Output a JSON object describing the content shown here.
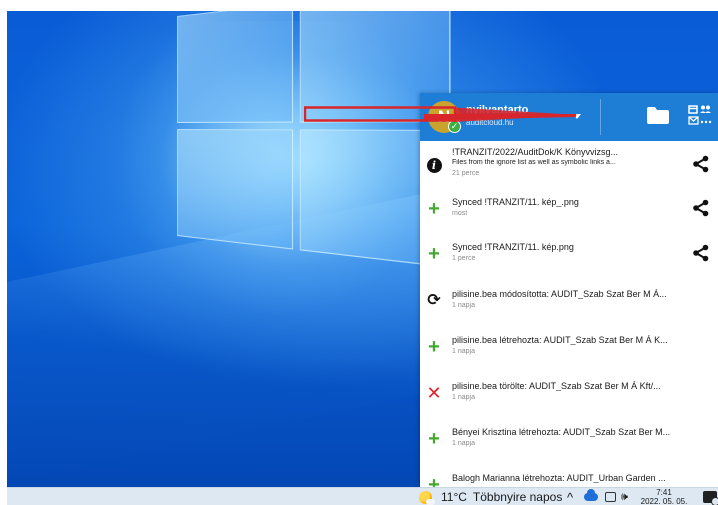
{
  "account": {
    "avatar_letter": "N",
    "name": "nyilvantarto",
    "server": "auditcloud.hu",
    "status_check": "✓"
  },
  "header": {
    "accent_color": "#1e7ed6",
    "files_icon": "folder-icon",
    "apps_icon": "apps-menu-icon"
  },
  "activities": [
    {
      "icon": "info-icon",
      "title": "!TRANZIT/2022/AuditDok/K Könyvvizsg...",
      "detail": "Files from the ignore list as well as symbolic links a...",
      "time": "21 perce",
      "has_share": true
    },
    {
      "icon": "plus-icon",
      "title": "Synced !TRANZIT/11. kép_.png",
      "detail": "",
      "time": "most",
      "has_share": true
    },
    {
      "icon": "plus-icon",
      "title": "Synced !TRANZIT/11. kép.png",
      "detail": "",
      "time": "1 perce",
      "has_share": true
    },
    {
      "icon": "sync-icon",
      "title": "pilisine.bea módosította: AUDIT_Szab Szat Ber M Á...",
      "detail": "",
      "time": "1 napja",
      "has_share": false
    },
    {
      "icon": "plus-icon",
      "title": "pilisine.bea létrehozta: AUDIT_Szab Szat Ber M Á K...",
      "detail": "",
      "time": "1 napja",
      "has_share": false
    },
    {
      "icon": "x-icon",
      "title": "pilisine.bea törölte: AUDIT_Szab Szat Ber M Á Kft/...",
      "detail": "",
      "time": "1 napja",
      "has_share": false
    },
    {
      "icon": "plus-icon",
      "title": "Bényei Krisztina létrehozta: AUDIT_Szab Szat Ber M...",
      "detail": "",
      "time": "1 napja",
      "has_share": false
    },
    {
      "icon": "plus-icon",
      "title": "Balogh Marianna létrehozta: AUDIT_Urban Garden ...",
      "detail": "",
      "time": "",
      "has_share": false
    }
  ],
  "taskbar": {
    "temperature": "11°C",
    "weather_text": "Többnyire napos",
    "tray_arrow": "^",
    "time": "7:41",
    "date": "2022. 05. 05."
  }
}
